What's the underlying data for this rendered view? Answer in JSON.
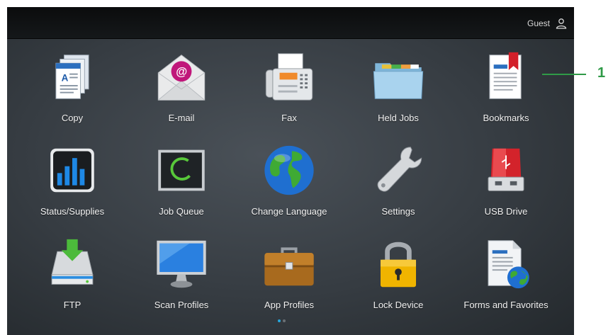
{
  "topbar": {
    "user_label": "Guest",
    "user_icon": "person-icon"
  },
  "apps": [
    {
      "label": "Copy",
      "icon": "copy-icon"
    },
    {
      "label": "E-mail",
      "icon": "email-icon"
    },
    {
      "label": "Fax",
      "icon": "fax-icon"
    },
    {
      "label": "Held Jobs",
      "icon": "folder-icon"
    },
    {
      "label": "Bookmarks",
      "icon": "bookmark-icon"
    },
    {
      "label": "Status/Supplies",
      "icon": "bar-chart-icon"
    },
    {
      "label": "Job Queue",
      "icon": "job-queue-icon"
    },
    {
      "label": "Change Language",
      "icon": "globe-icon"
    },
    {
      "label": "Settings",
      "icon": "wrench-icon"
    },
    {
      "label": "USB Drive",
      "icon": "usb-drive-icon"
    },
    {
      "label": "FTP",
      "icon": "ftp-icon"
    },
    {
      "label": "Scan Profiles",
      "icon": "monitor-icon"
    },
    {
      "label": "App Profiles",
      "icon": "briefcase-icon"
    },
    {
      "label": "Lock Device",
      "icon": "padlock-icon"
    },
    {
      "label": "Forms and Favorites",
      "icon": "forms-globe-icon"
    }
  ],
  "pager": {
    "pages": 2,
    "current": 1
  },
  "callout": {
    "number": "1"
  },
  "colors": {
    "accent": "#25a7dd",
    "callout": "#2f9a47"
  }
}
